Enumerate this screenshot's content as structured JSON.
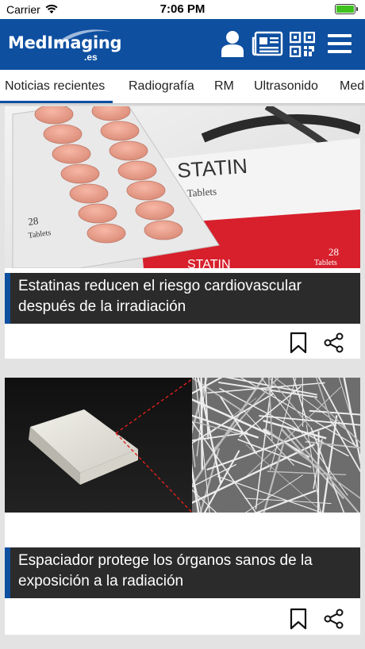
{
  "status_bar": {
    "carrier": "Carrier",
    "time": "7:06 PM",
    "battery_level": 1.0
  },
  "header": {
    "logo_text": "MedImaging",
    "logo_tld": ".es",
    "icons": [
      "user-icon",
      "newspaper-icon",
      "qr-code-icon",
      "menu-icon"
    ],
    "background_color": "#0e4fa0"
  },
  "tabs": [
    {
      "label": "Noticias recientes",
      "active": true
    },
    {
      "label": "Radiografía",
      "active": false
    },
    {
      "label": "RM",
      "active": false
    },
    {
      "label": "Ultrasonido",
      "active": false
    },
    {
      "label": "Med",
      "active": false
    }
  ],
  "articles": [
    {
      "headline": "Estatinas reducen el riesgo cardiovascular después de la irradiación",
      "image_text": {
        "box_brand": "STATIN",
        "box_sub": "Tablets",
        "count": "28",
        "count_sub": "Tablets",
        "count_box": "28",
        "count_box_sub": "Tablets",
        "box_side": "STATIN"
      },
      "actions": [
        "bookmark-icon",
        "share-icon"
      ]
    },
    {
      "headline": "Espaciador protege los órganos sanos de la exposición a la radiación",
      "actions": [
        "bookmark-icon",
        "share-icon"
      ]
    }
  ],
  "accent_color": "#0e4fa0"
}
